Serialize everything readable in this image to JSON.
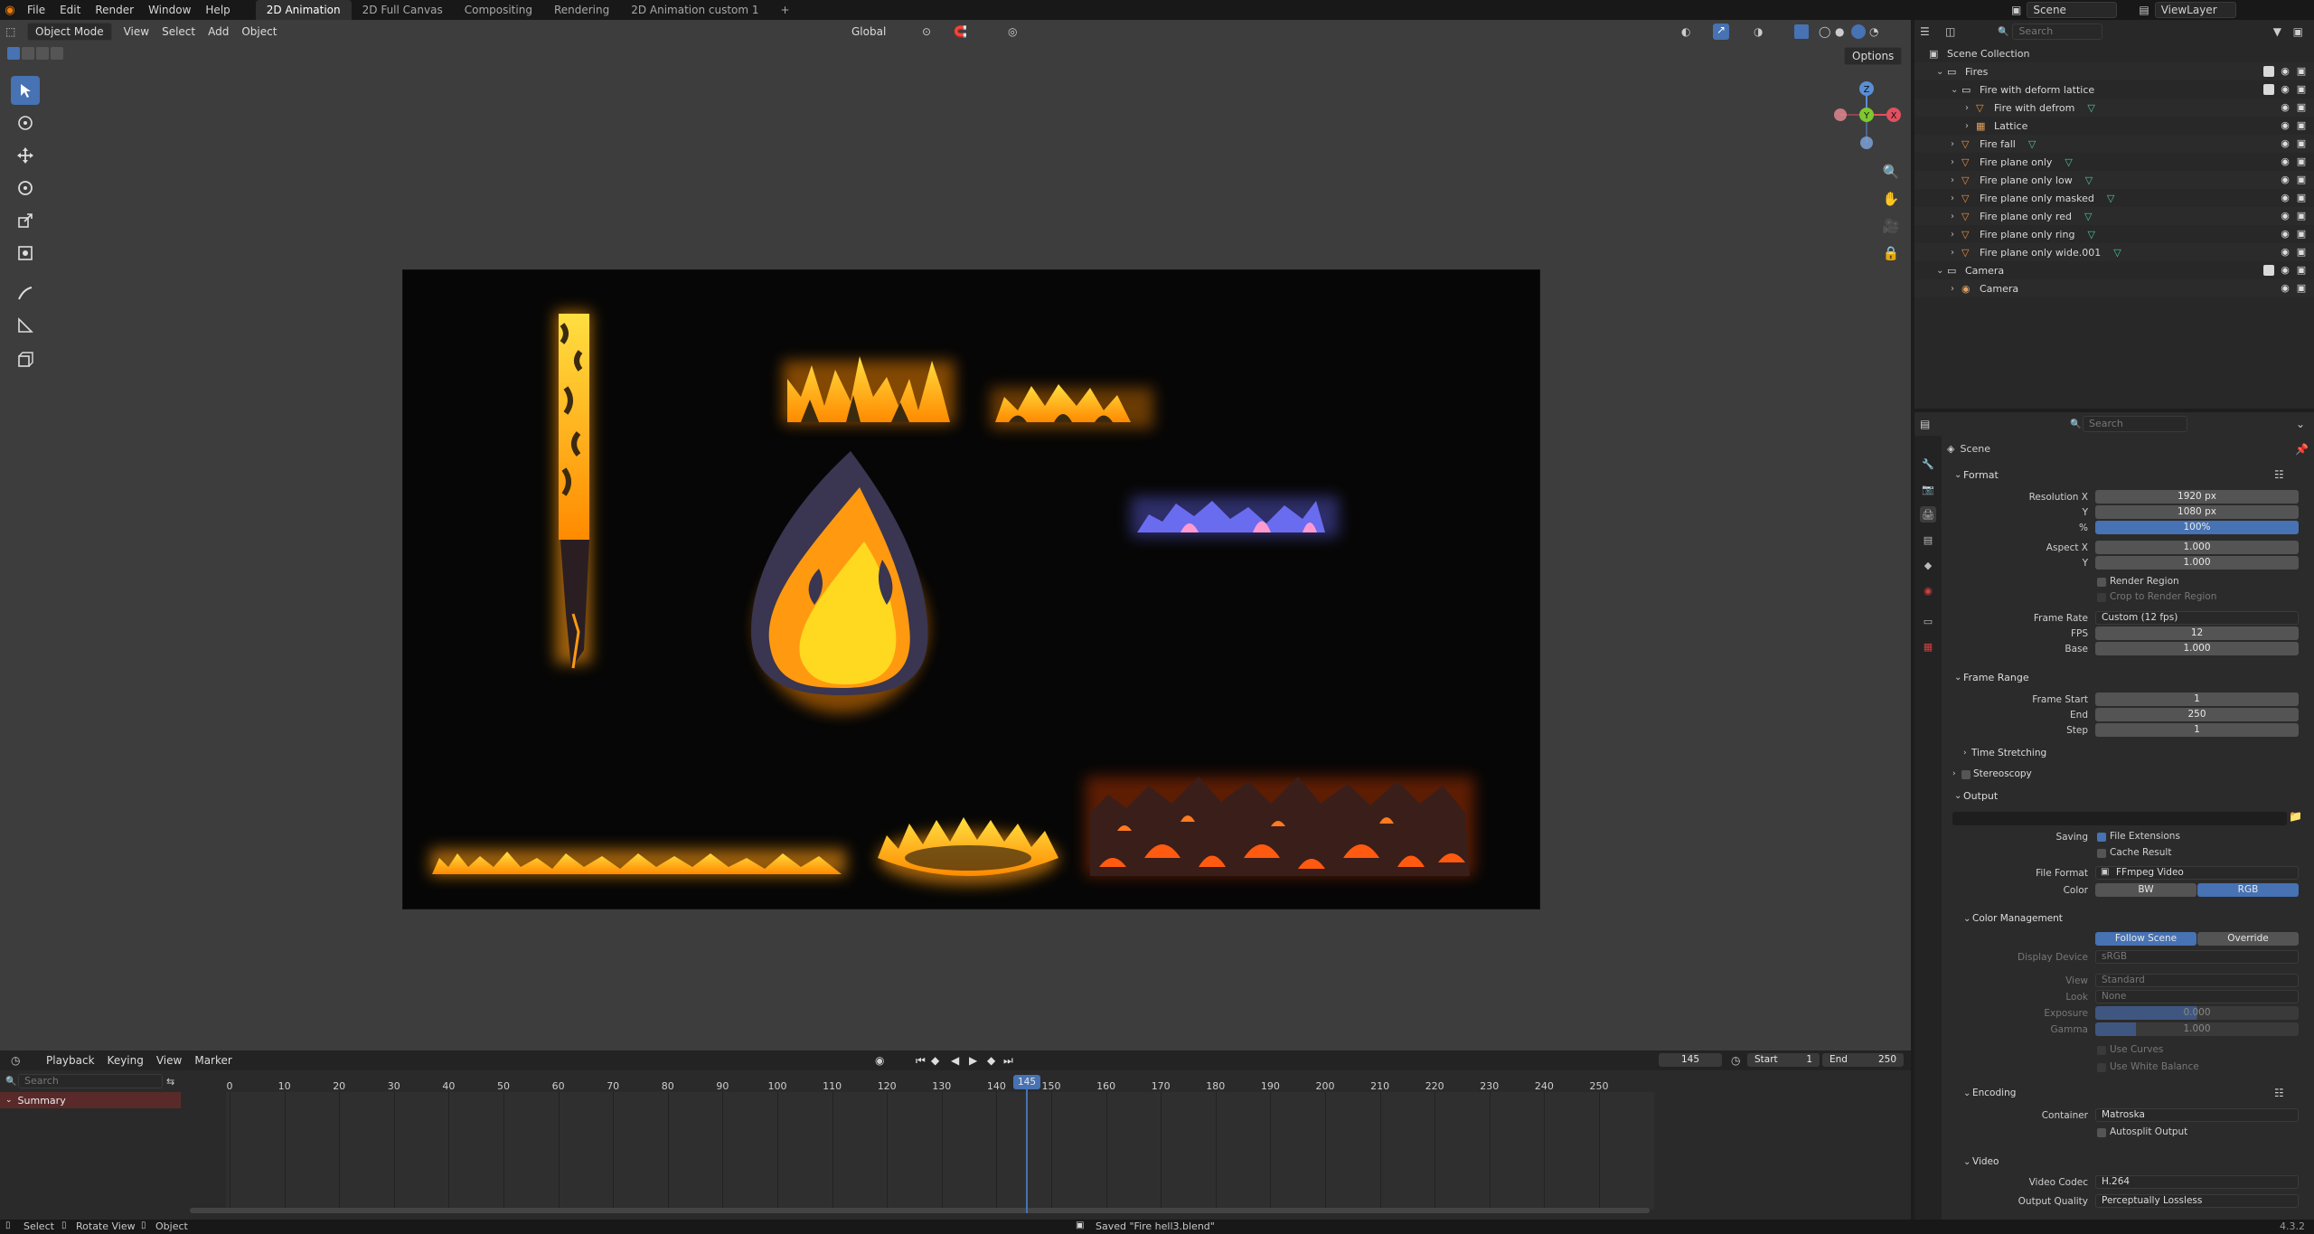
{
  "topbar": {
    "menus": [
      "File",
      "Edit",
      "Render",
      "Window",
      "Help"
    ],
    "workspaces": [
      "2D Animation",
      "2D Full Canvas",
      "Compositing",
      "Rendering",
      "2D Animation custom 1"
    ],
    "active_workspace": "2D Animation",
    "add_workspace": "+",
    "scene": "Scene",
    "view_layer": "ViewLayer"
  },
  "viewport": {
    "mode": "Object Mode",
    "menus": [
      "View",
      "Select",
      "Add",
      "Object"
    ],
    "transform_orientation": "Global",
    "options": "Options",
    "gizmo": {
      "z": "Z",
      "y": "Y",
      "x": "X"
    }
  },
  "outliner": {
    "search_placeholder": "Search",
    "title": "Scene Collection",
    "rows": [
      {
        "label": "Fires",
        "indent": 1,
        "icon": "collection",
        "check": true
      },
      {
        "label": "Fire with deform lattice",
        "indent": 2,
        "icon": "collection",
        "check": true
      },
      {
        "label": "Fire with defrom",
        "indent": 3,
        "icon": "object"
      },
      {
        "label": "Lattice",
        "indent": 3,
        "icon": "lattice"
      },
      {
        "label": "Fire fall",
        "indent": 2,
        "icon": "object"
      },
      {
        "label": "Fire plane only",
        "indent": 2,
        "icon": "object"
      },
      {
        "label": "Fire plane only low",
        "indent": 2,
        "icon": "object"
      },
      {
        "label": "Fire plane only masked",
        "indent": 2,
        "icon": "object"
      },
      {
        "label": "Fire plane only red",
        "indent": 2,
        "icon": "object"
      },
      {
        "label": "Fire plane only ring",
        "indent": 2,
        "icon": "object"
      },
      {
        "label": "Fire plane only wide.001",
        "indent": 2,
        "icon": "object"
      },
      {
        "label": "Camera",
        "indent": 1,
        "icon": "collection",
        "check": true
      },
      {
        "label": "Camera",
        "indent": 2,
        "icon": "camera"
      }
    ]
  },
  "properties": {
    "search_placeholder": "Search",
    "breadcrumb": "Scene",
    "format": {
      "title": "Format",
      "res_x_label": "Resolution X",
      "res_x": "1920 px",
      "res_y_label": "Y",
      "res_y": "1080 px",
      "pct_label": "%",
      "pct": "100%",
      "aspect_x_label": "Aspect X",
      "aspect_x": "1.000",
      "aspect_y_label": "Y",
      "aspect_y": "1.000",
      "render_region": "Render Region",
      "crop": "Crop to Render Region",
      "frame_rate_label": "Frame Rate",
      "frame_rate": "Custom (12 fps)",
      "fps_label": "FPS",
      "fps": "12",
      "base_label": "Base",
      "base": "1.000"
    },
    "frame_range": {
      "title": "Frame Range",
      "start_label": "Frame Start",
      "start": "1",
      "end_label": "End",
      "end": "250",
      "step_label": "Step",
      "step": "1"
    },
    "time_stretching": "Time Stretching",
    "stereoscopy": "Stereoscopy",
    "output": {
      "title": "Output",
      "saving_label": "Saving",
      "file_ext": "File Extensions",
      "cache": "Cache Result",
      "file_format_label": "File Format",
      "file_format": "FFmpeg Video",
      "color_label": "Color",
      "bw": "BW",
      "rgb": "RGB"
    },
    "color_management": {
      "title": "Color Management",
      "follow": "Follow Scene",
      "override": "Override",
      "display_label": "Display Device",
      "display": "sRGB",
      "view_label": "View",
      "view": "Standard",
      "look_label": "Look",
      "look": "None",
      "exposure_label": "Exposure",
      "exposure": "0.000",
      "gamma_label": "Gamma",
      "gamma": "1.000",
      "use_curves": "Use Curves",
      "use_white": "Use White Balance"
    },
    "encoding": {
      "title": "Encoding",
      "container_label": "Container",
      "container": "Matroska",
      "autosplit": "Autosplit Output"
    },
    "video": {
      "title": "Video",
      "codec_label": "Video Codec",
      "codec": "H.264",
      "quality_label": "Output Quality",
      "quality": "Perceptually Lossless"
    }
  },
  "timeline": {
    "menus": [
      "Playback",
      "Keying",
      "View",
      "Marker"
    ],
    "current_frame": "145",
    "start_label": "Start",
    "start": "1",
    "end_label": "End",
    "end": "250",
    "search_placeholder": "Search",
    "summary": "Summary",
    "ticks": [
      "0",
      "10",
      "20",
      "30",
      "40",
      "50",
      "60",
      "70",
      "80",
      "90",
      "100",
      "110",
      "120",
      "130",
      "140",
      "145",
      "150",
      "160",
      "170",
      "180",
      "190",
      "200",
      "210",
      "220",
      "230",
      "240",
      "250"
    ]
  },
  "status": {
    "select": "Select",
    "rotate": "Rotate View",
    "object": "Object",
    "message": "Saved \"Fire hell3.blend\"",
    "version": "4.3.2"
  }
}
